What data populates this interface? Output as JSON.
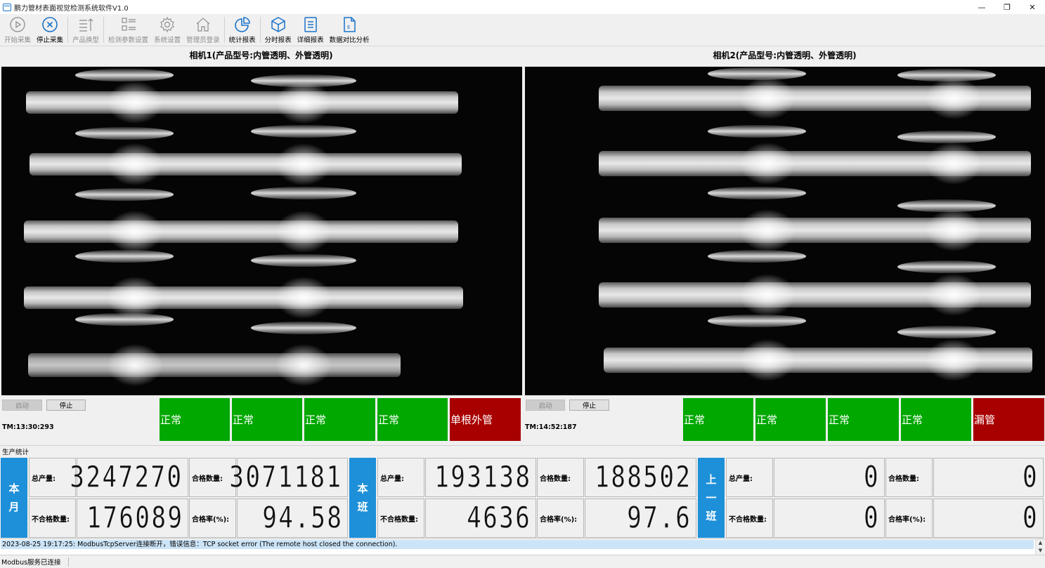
{
  "window": {
    "title": "鹏力管材表面视觉检测系统软件V1.0",
    "controls": [
      "—",
      "❐",
      "✕"
    ]
  },
  "toolbar": {
    "items": [
      {
        "label": "开始采集",
        "icon": "play-circle-icon",
        "enabled": false
      },
      {
        "label": "停止采集",
        "icon": "stop-circle-icon",
        "enabled": true
      },
      {
        "label": "产品换型",
        "icon": "list-sort-icon",
        "enabled": false
      },
      {
        "label": "检测参数设置",
        "icon": "grid-list-icon",
        "enabled": false
      },
      {
        "label": "系统设置",
        "icon": "gear-icon",
        "enabled": false
      },
      {
        "label": "管理员登录",
        "icon": "home-icon",
        "enabled": false
      },
      {
        "label": "统计报表",
        "icon": "pie-chart-icon",
        "enabled": true
      },
      {
        "label": "分时报表",
        "icon": "cube-icon",
        "enabled": true
      },
      {
        "label": "详细报表",
        "icon": "document-list-icon",
        "enabled": true
      },
      {
        "label": "数据对比分析",
        "icon": "excel-file-icon",
        "enabled": true
      }
    ]
  },
  "cameras": [
    {
      "title": "相机1(产品型号:内管透明、外管透明)",
      "start_label": "启动",
      "stop_label": "停止",
      "tm": "TM:13:30:293",
      "results": [
        {
          "text": "正常",
          "state": "ok"
        },
        {
          "text": "正常",
          "state": "ok"
        },
        {
          "text": "正常",
          "state": "ok"
        },
        {
          "text": "正常",
          "state": "ok"
        },
        {
          "text": "单根外管",
          "state": "ng"
        }
      ]
    },
    {
      "title": "相机2(产品型号:内管透明、外管透明)",
      "start_label": "启动",
      "stop_label": "停止",
      "tm": "TM:14:52:187",
      "results": [
        {
          "text": "正常",
          "state": "ok"
        },
        {
          "text": "正常",
          "state": "ok"
        },
        {
          "text": "正常",
          "state": "ok"
        },
        {
          "text": "正常",
          "state": "ok"
        },
        {
          "text": "漏管",
          "state": "ng"
        }
      ]
    }
  ],
  "production": {
    "section_label": "生产统计",
    "labels": {
      "total": "总产量:",
      "pass": "合格数量:",
      "fail": "不合格数量:",
      "rate": "合格率(%):"
    },
    "periods": [
      {
        "name": [
          "本",
          "月"
        ],
        "total": "3247270",
        "pass": "3071181",
        "fail": "176089",
        "rate": "94.58"
      },
      {
        "name": [
          "本",
          "班"
        ],
        "total": "193138",
        "pass": "188502",
        "fail": "4636",
        "rate": "97.6"
      },
      {
        "name": [
          "上",
          "一",
          "班"
        ],
        "total": "0",
        "pass": "0",
        "fail": "0",
        "rate": "0"
      }
    ]
  },
  "log": {
    "line": "2023-08-25 19:17:25: ModbusTcpServer连接断开，错误信息：TCP socket error (The remote host closed the connection)."
  },
  "statusbar": {
    "text": "Modbus服务已连接"
  },
  "colors": {
    "ok": "#00a800",
    "ng": "#a80000",
    "period": "#1e90d9",
    "accent_icon": "#1a73c9"
  }
}
